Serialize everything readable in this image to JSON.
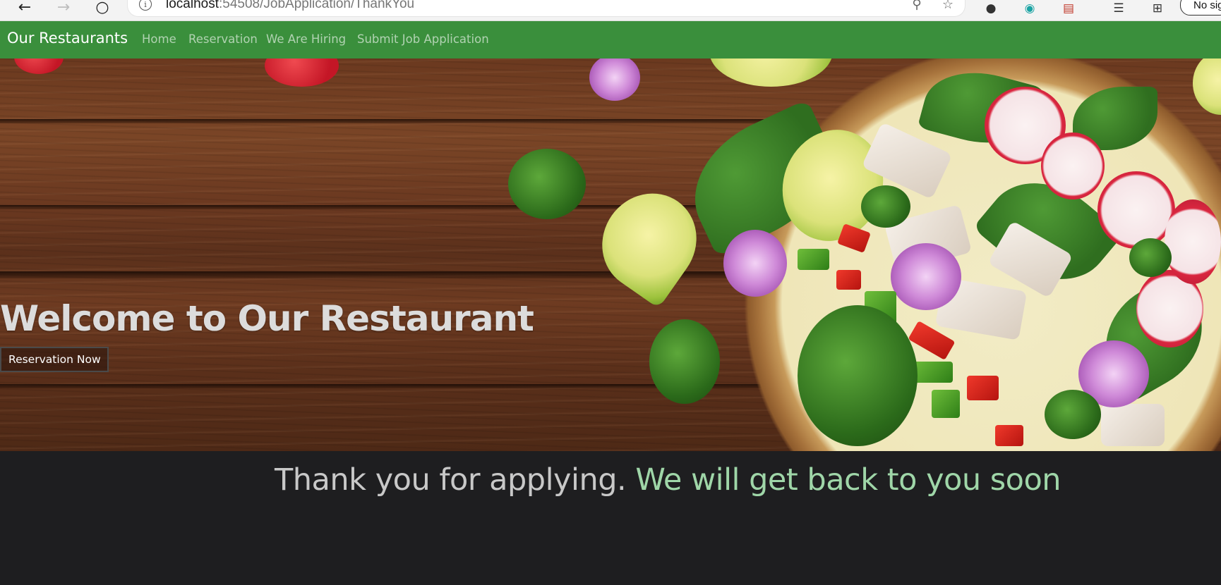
{
  "browser": {
    "url_host": "localhost",
    "url_rest": ":54508/JobApplication/ThankYou",
    "profile_label": "No sig"
  },
  "navbar": {
    "brand": "Our Restaurants",
    "links": [
      "Home",
      "Reservation",
      "We Are Hiring",
      "Submit Job Application"
    ],
    "background": "#3a8f3c"
  },
  "hero": {
    "title": "Welcome to Our Restaurant",
    "button_label": "Reservation Now"
  },
  "message": {
    "part1": "Thank you for applying. ",
    "part2": "We will get back to you soon",
    "color_part1": "#c8c8c8",
    "color_part2": "#9fd6a8"
  },
  "icons": {
    "back": "back-arrow-icon",
    "forward": "forward-arrow-icon",
    "refresh": "refresh-icon",
    "info": "info-icon",
    "zoom": "zoom-out-icon",
    "favorite": "star-icon"
  }
}
